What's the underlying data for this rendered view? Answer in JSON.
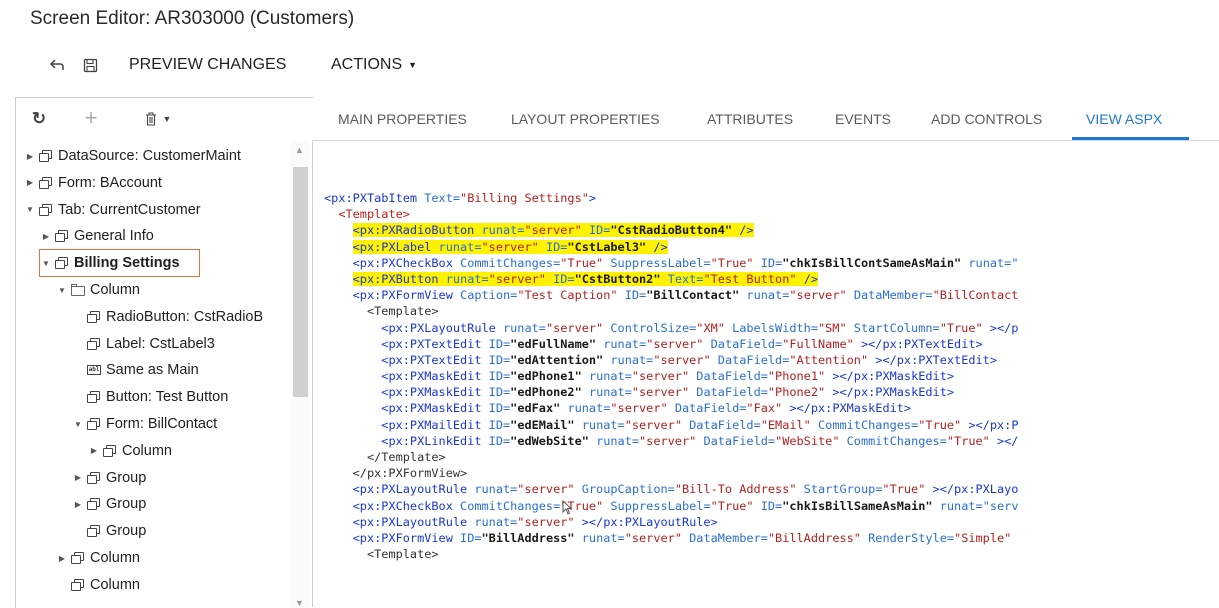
{
  "title": "Screen Editor: AR303000 (Customers)",
  "toolbar": {
    "preview_label": "PREVIEW CHANGES",
    "actions_label": "ACTIONS"
  },
  "tree": [
    {
      "label": "DataSource: CustomerMaint",
      "depth": 0,
      "toggle": "collapsed",
      "icon": "frame-icon"
    },
    {
      "label": "Form: BAccount",
      "depth": 0,
      "toggle": "collapsed",
      "icon": "frame-icon"
    },
    {
      "label": "Tab: CurrentCustomer",
      "depth": 0,
      "toggle": "expanded",
      "icon": "frame-icon"
    },
    {
      "label": "General Info",
      "depth": 1,
      "toggle": "collapsed",
      "icon": "frame-icon"
    },
    {
      "label": "Billing Settings",
      "depth": 1,
      "toggle": "expanded",
      "icon": "frame-icon",
      "selected": true
    },
    {
      "label": "Column",
      "depth": 2,
      "toggle": "expanded",
      "icon": "folder-icon"
    },
    {
      "label": "RadioButton: CstRadioB",
      "depth": 3,
      "toggle": "none",
      "icon": "frame-icon"
    },
    {
      "label": "Label: CstLabel3",
      "depth": 3,
      "toggle": "none",
      "icon": "frame-icon"
    },
    {
      "label": "Same as Main",
      "depth": 3,
      "toggle": "none",
      "icon": "textbox-icon"
    },
    {
      "label": "Button: Test Button",
      "depth": 3,
      "toggle": "none",
      "icon": "frame-icon"
    },
    {
      "label": "Form: BillContact",
      "depth": 3,
      "toggle": "expanded",
      "icon": "frame-icon"
    },
    {
      "label": "Column",
      "depth": 4,
      "toggle": "collapsed",
      "icon": "frame-icon"
    },
    {
      "label": "Group",
      "depth": 3,
      "toggle": "collapsed",
      "icon": "frame-icon"
    },
    {
      "label": "Group",
      "depth": 3,
      "toggle": "collapsed",
      "icon": "frame-icon"
    },
    {
      "label": "Group",
      "depth": 3,
      "toggle": "none",
      "icon": "frame-icon"
    },
    {
      "label": "Column",
      "depth": 2,
      "toggle": "collapsed",
      "icon": "frame-icon"
    },
    {
      "label": "Column",
      "depth": 2,
      "toggle": "none",
      "icon": "frame-icon"
    }
  ],
  "tabs": [
    {
      "label": "MAIN PROPERTIES"
    },
    {
      "label": "LAYOUT PROPERTIES"
    },
    {
      "label": "ATTRIBUTES"
    },
    {
      "label": "EVENTS"
    },
    {
      "label": "ADD CONTROLS"
    },
    {
      "label": "VIEW ASPX",
      "active": true
    }
  ],
  "colors": {
    "accent": "#1f78d1",
    "selection_border": "#e8723c",
    "highlight": "#fff200"
  },
  "code": [
    {
      "indent": 0,
      "parts": [
        [
          "t",
          "<px:PXTabItem "
        ],
        [
          "a",
          "Text="
        ],
        [
          "v",
          "\"Billing Settings\""
        ],
        [
          "t",
          ">"
        ]
      ]
    },
    {
      "indent": 2,
      "parts": [
        [
          "tmpl",
          "<Template>"
        ]
      ]
    },
    {
      "indent": 4,
      "hl": true,
      "parts": [
        [
          "t",
          "<px:PXRadioButton "
        ],
        [
          "a",
          "runat="
        ],
        [
          "v",
          "\"server\" "
        ],
        [
          "a",
          "ID="
        ],
        [
          "b",
          "\"CstRadioButton4\""
        ],
        [
          "t",
          " />"
        ]
      ]
    },
    {
      "indent": 4,
      "hl": true,
      "parts": [
        [
          "t",
          "<px:PXLabel "
        ],
        [
          "a",
          "runat="
        ],
        [
          "v",
          "\"server\" "
        ],
        [
          "a",
          "ID="
        ],
        [
          "b",
          "\"CstLabel3\""
        ],
        [
          "t",
          " />"
        ]
      ]
    },
    {
      "indent": 4,
      "parts": [
        [
          "t",
          "<px:PXCheckBox "
        ],
        [
          "a",
          "CommitChanges="
        ],
        [
          "v",
          "\"True\" "
        ],
        [
          "a",
          "SuppressLabel="
        ],
        [
          "v",
          "\"True\" "
        ],
        [
          "a",
          "ID="
        ],
        [
          "b",
          "\"chkIsBillContSameAsMain\""
        ],
        [
          "a",
          " runat=\""
        ]
      ]
    },
    {
      "indent": 4,
      "hl": true,
      "parts": [
        [
          "t",
          "<px:PXButton "
        ],
        [
          "a",
          "runat="
        ],
        [
          "v",
          "\"server\" "
        ],
        [
          "a",
          "ID="
        ],
        [
          "b",
          "\"CstButton2\" "
        ],
        [
          "a",
          "Text="
        ],
        [
          "v",
          "\"Test Button\""
        ],
        [
          "t",
          " />"
        ]
      ]
    },
    {
      "indent": 4,
      "parts": [
        [
          "t",
          "<px:PXFormView "
        ],
        [
          "a",
          "Caption="
        ],
        [
          "v",
          "\"Test Caption\" "
        ],
        [
          "a",
          "ID="
        ],
        [
          "b",
          "\"BillContact\" "
        ],
        [
          "a",
          "runat="
        ],
        [
          "v",
          "\"server\" "
        ],
        [
          "a",
          "DataMember="
        ],
        [
          "v",
          "\"BillContact"
        ]
      ]
    },
    {
      "indent": 6,
      "parts": [
        [
          "k",
          "<Template>"
        ]
      ]
    },
    {
      "indent": 8,
      "parts": [
        [
          "t",
          "<px:PXLayoutRule "
        ],
        [
          "a",
          "runat="
        ],
        [
          "v",
          "\"server\" "
        ],
        [
          "a",
          "ControlSize="
        ],
        [
          "v",
          "\"XM\" "
        ],
        [
          "a",
          "LabelsWidth="
        ],
        [
          "v",
          "\"SM\" "
        ],
        [
          "a",
          "StartColumn="
        ],
        [
          "v",
          "\"True\""
        ],
        [
          "t",
          " ></p"
        ]
      ]
    },
    {
      "indent": 8,
      "parts": [
        [
          "t",
          "<px:PXTextEdit "
        ],
        [
          "a",
          "ID="
        ],
        [
          "b",
          "\"edFullName\" "
        ],
        [
          "a",
          "runat="
        ],
        [
          "v",
          "\"server\" "
        ],
        [
          "a",
          "DataField="
        ],
        [
          "v",
          "\"FullName\""
        ],
        [
          "t",
          " ></px:PXTextEdit>"
        ]
      ]
    },
    {
      "indent": 8,
      "parts": [
        [
          "t",
          "<px:PXTextEdit "
        ],
        [
          "a",
          "ID="
        ],
        [
          "b",
          "\"edAttention\" "
        ],
        [
          "a",
          "runat="
        ],
        [
          "v",
          "\"server\" "
        ],
        [
          "a",
          "DataField="
        ],
        [
          "v",
          "\"Attention\""
        ],
        [
          "t",
          " ></px:PXTextEdit>"
        ]
      ]
    },
    {
      "indent": 8,
      "parts": [
        [
          "t",
          "<px:PXMaskEdit "
        ],
        [
          "a",
          "ID="
        ],
        [
          "b",
          "\"edPhone1\" "
        ],
        [
          "a",
          "runat="
        ],
        [
          "v",
          "\"server\" "
        ],
        [
          "a",
          "DataField="
        ],
        [
          "v",
          "\"Phone1\""
        ],
        [
          "t",
          " ></px:PXMaskEdit>"
        ]
      ]
    },
    {
      "indent": 8,
      "parts": [
        [
          "t",
          "<px:PXMaskEdit "
        ],
        [
          "a",
          "ID="
        ],
        [
          "b",
          "\"edPhone2\" "
        ],
        [
          "a",
          "runat="
        ],
        [
          "v",
          "\"server\" "
        ],
        [
          "a",
          "DataField="
        ],
        [
          "v",
          "\"Phone2\""
        ],
        [
          "t",
          " ></px:PXMaskEdit>"
        ]
      ]
    },
    {
      "indent": 8,
      "parts": [
        [
          "t",
          "<px:PXMaskEdit "
        ],
        [
          "a",
          "ID="
        ],
        [
          "b",
          "\"edFax\" "
        ],
        [
          "a",
          "runat="
        ],
        [
          "v",
          "\"server\" "
        ],
        [
          "a",
          "DataField="
        ],
        [
          "v",
          "\"Fax\""
        ],
        [
          "t",
          " ></px:PXMaskEdit>"
        ]
      ]
    },
    {
      "indent": 8,
      "parts": [
        [
          "t",
          "<px:PXMailEdit "
        ],
        [
          "a",
          "ID="
        ],
        [
          "b",
          "\"edEMail\" "
        ],
        [
          "a",
          "runat="
        ],
        [
          "v",
          "\"server\" "
        ],
        [
          "a",
          "DataField="
        ],
        [
          "v",
          "\"EMail\" "
        ],
        [
          "a",
          "CommitChanges="
        ],
        [
          "v",
          "\"True\""
        ],
        [
          "t",
          " ></px:P"
        ]
      ]
    },
    {
      "indent": 8,
      "parts": [
        [
          "t",
          "<px:PXLinkEdit "
        ],
        [
          "a",
          "ID="
        ],
        [
          "b",
          "\"edWebSite\" "
        ],
        [
          "a",
          "runat="
        ],
        [
          "v",
          "\"server\" "
        ],
        [
          "a",
          "DataField="
        ],
        [
          "v",
          "\"WebSite\" "
        ],
        [
          "a",
          "CommitChanges="
        ],
        [
          "v",
          "\"True\""
        ],
        [
          "t",
          " ></"
        ]
      ]
    },
    {
      "indent": 6,
      "parts": [
        [
          "k",
          "</Template>"
        ]
      ]
    },
    {
      "indent": 4,
      "parts": [
        [
          "k",
          "</px:PXFormView>"
        ]
      ]
    },
    {
      "indent": 4,
      "parts": [
        [
          "t",
          "<px:PXLayoutRule "
        ],
        [
          "a",
          "runat="
        ],
        [
          "v",
          "\"server\" "
        ],
        [
          "a",
          "GroupCaption="
        ],
        [
          "v",
          "\"Bill-To Address\" "
        ],
        [
          "a",
          "StartGroup="
        ],
        [
          "v",
          "\"True\""
        ],
        [
          "t",
          " ></px:PXLayo"
        ]
      ]
    },
    {
      "indent": 4,
      "parts": [
        [
          "t",
          "<px:PXCheckBox "
        ],
        [
          "a",
          "CommitChanges="
        ],
        [
          "v",
          "\"True\" "
        ],
        [
          "a",
          "SuppressLabel="
        ],
        [
          "v",
          "\"True\" "
        ],
        [
          "a",
          "ID="
        ],
        [
          "b",
          "\"chkIsBillSameAsMain\""
        ],
        [
          "a",
          " runat=\"serv"
        ]
      ]
    },
    {
      "indent": 4,
      "parts": [
        [
          "t",
          "<px:PXLayoutRule "
        ],
        [
          "a",
          "runat="
        ],
        [
          "v",
          "\"server\""
        ],
        [
          "t",
          " ></px:PXLayoutRule>"
        ]
      ]
    },
    {
      "indent": 4,
      "parts": [
        [
          "t",
          "<px:PXFormView "
        ],
        [
          "a",
          "ID="
        ],
        [
          "b",
          "\"BillAddress\" "
        ],
        [
          "a",
          "runat="
        ],
        [
          "v",
          "\"server\" "
        ],
        [
          "a",
          "DataMember="
        ],
        [
          "v",
          "\"BillAddress\" "
        ],
        [
          "a",
          "RenderStyle="
        ],
        [
          "v",
          "\"Simple\" "
        ]
      ]
    },
    {
      "indent": 6,
      "parts": [
        [
          "k",
          "<Template>"
        ]
      ]
    }
  ]
}
